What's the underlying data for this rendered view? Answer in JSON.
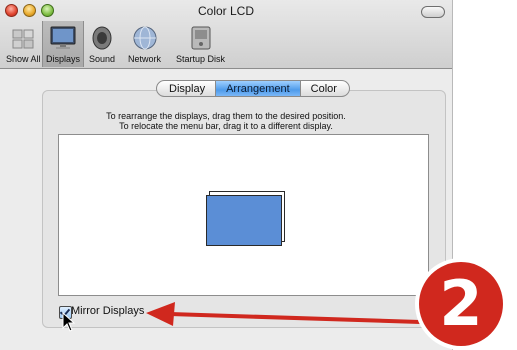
{
  "window": {
    "title": "Color LCD"
  },
  "toolbar": {
    "items": [
      {
        "label": "Show All",
        "icon": "show-all-icon"
      },
      {
        "label": "Displays",
        "icon": "display-icon",
        "selected": true
      },
      {
        "label": "Sound",
        "icon": "speaker-icon"
      },
      {
        "label": "Network",
        "icon": "network-globe-icon"
      },
      {
        "label": "Startup Disk",
        "icon": "startup-disk-icon"
      }
    ]
  },
  "tabs": [
    {
      "label": "Display"
    },
    {
      "label": "Arrangement",
      "active": true
    },
    {
      "label": "Color"
    }
  ],
  "arrangement": {
    "instruction_line1": "To rearrange the displays, drag them to the desired position.",
    "instruction_line2": "To relocate the menu bar, drag it to a different display."
  },
  "mirror": {
    "label": "Mirror Displays",
    "checked": true
  },
  "callout": {
    "number": "2",
    "color": "#d0281e"
  }
}
